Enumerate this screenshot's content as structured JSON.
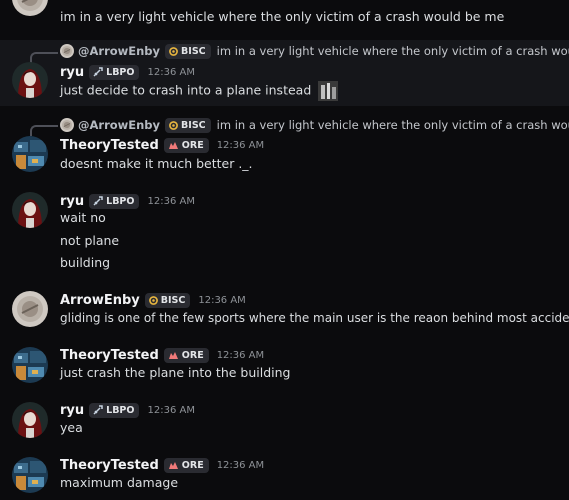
{
  "messages": [
    {
      "text": "im in a very light vehicle where the only victim of a crash would be me"
    },
    {
      "reply": {
        "author": "@ArrowEnby",
        "tag": "BISC",
        "text": "im in a very light vehicle where the only victim of a crash would be me"
      },
      "author": "ryu",
      "tag": "LBPO",
      "time": "12:36 AM",
      "lines": [
        "just decide to crash into a plane instead"
      ]
    },
    {
      "reply": {
        "author": "@ArrowEnby",
        "tag": "BISC",
        "text": "im in a very light vehicle where the only victim of a crash would be me"
      },
      "author": "TheoryTested",
      "tag": "ORE",
      "time": "12:36 AM",
      "lines": [
        "doesnt make it much better ._."
      ]
    },
    {
      "author": "ryu",
      "tag": "LBPO",
      "time": "12:36 AM",
      "lines": [
        "wait no",
        "not plane",
        "building"
      ]
    },
    {
      "author": "ArrowEnby",
      "tag": "BISC",
      "time": "12:36 AM",
      "lines": [
        "gliding is one of the few sports where  the main user is the reaon behind most accidents"
      ]
    },
    {
      "author": "TheoryTested",
      "tag": "ORE",
      "time": "12:36 AM",
      "lines": [
        "just crash the plane into the building"
      ]
    },
    {
      "author": "ryu",
      "tag": "LBPO",
      "time": "12:36 AM",
      "lines": [
        "yea"
      ]
    },
    {
      "author": "TheoryTested",
      "tag": "ORE",
      "time": "12:36 AM",
      "lines": [
        "maximum damage"
      ]
    }
  ]
}
